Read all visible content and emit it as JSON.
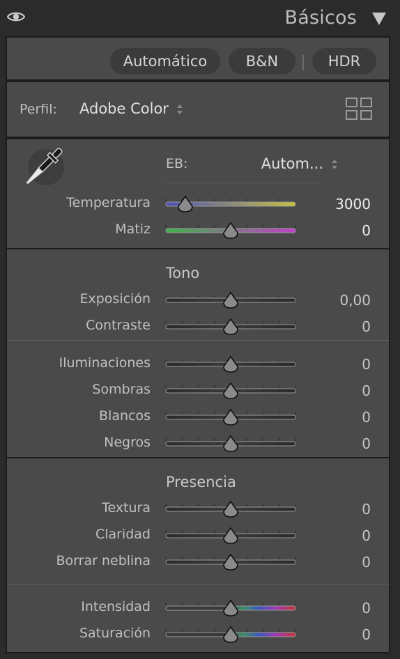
{
  "header": {
    "title": "Básicos",
    "eye_icon": "eye-icon",
    "collapse_icon": "triangle-down-icon"
  },
  "treatment": {
    "auto": "Automático",
    "bw": "B&N",
    "hdr": "HDR"
  },
  "profile": {
    "label": "Perfil:",
    "value": "Adobe Color",
    "browse_icon": "grid-icon"
  },
  "white_balance": {
    "label": "EB:",
    "value": "Autom...",
    "picker_icon": "eyedropper-icon",
    "temperature": {
      "label": "Temperatura",
      "value": "3000",
      "level": 0.15
    },
    "tint": {
      "label": "Matiz",
      "value": "0",
      "level": 0.5
    }
  },
  "tone": {
    "title": "Tono",
    "exposure": {
      "label": "Exposición",
      "value": "0,00",
      "level": 0.5
    },
    "contrast": {
      "label": "Contraste",
      "value": "0",
      "level": 0.5
    },
    "highlights": {
      "label": "Iluminaciones",
      "value": "0",
      "level": 0.5
    },
    "shadows": {
      "label": "Sombras",
      "value": "0",
      "level": 0.5
    },
    "whites": {
      "label": "Blancos",
      "value": "0",
      "level": 0.5
    },
    "blacks": {
      "label": "Negros",
      "value": "0",
      "level": 0.5
    }
  },
  "presence": {
    "title": "Presencia",
    "texture": {
      "label": "Textura",
      "value": "0",
      "level": 0.5
    },
    "clarity": {
      "label": "Claridad",
      "value": "0",
      "level": 0.5
    },
    "dehaze": {
      "label": "Borrar neblina",
      "value": "0",
      "level": 0.5
    },
    "vibrance": {
      "label": "Intensidad",
      "value": "0",
      "level": 0.5
    },
    "saturation": {
      "label": "Saturación",
      "value": "0",
      "level": 0.5
    }
  },
  "colors": {
    "panel_bg": "#4a4a4a",
    "page_bg": "#2b2b2b",
    "track_dark": "#2a2a2a",
    "temperature_track": [
      "#4b4fb8",
      "#c8c23a"
    ],
    "tint_track": [
      "#3fb24a",
      "#c33ec7"
    ]
  }
}
